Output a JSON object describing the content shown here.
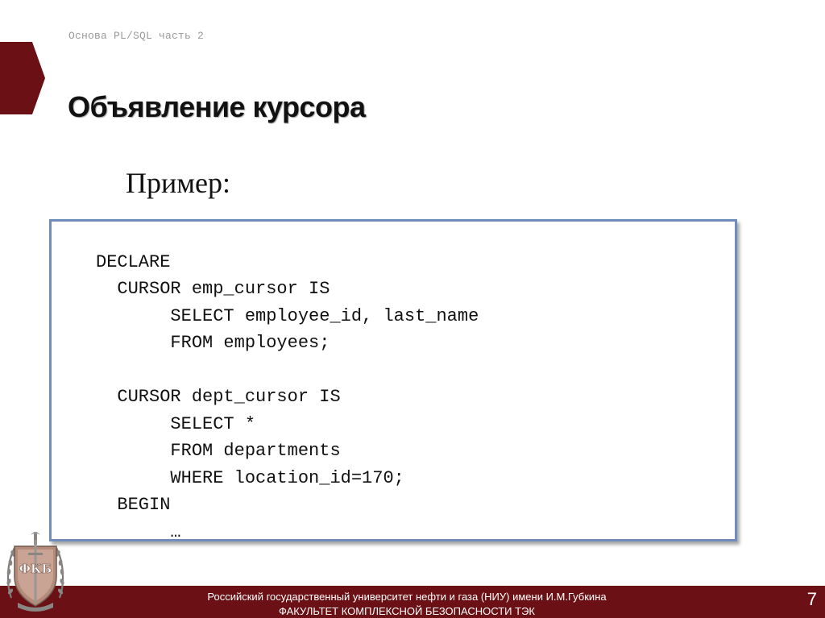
{
  "header": {
    "subtitle": "Основа PL/SQL часть 2"
  },
  "title": "Объявление курсора",
  "example_label": "Пример:",
  "code": {
    "lines": [
      "DECLARE",
      "  CURSOR emp_cursor IS",
      "       SELECT employee_id, last_name",
      "       FROM employees;",
      "",
      "  CURSOR dept_cursor IS",
      "       SELECT *",
      "       FROM departments",
      "       WHERE location_id=170;",
      "  BEGIN",
      "       …"
    ]
  },
  "footer": {
    "university": "Российский государственный университет нефти и газа (НИУ) имени И.М.Губкина",
    "faculty": "ФАКУЛЬТЕТ КОМПЛЕКСНОЙ БЕЗОПАСНОСТИ ТЭК",
    "page_number": "7"
  },
  "logo": {
    "icon": "faculty-emblem-icon",
    "text": "ФКБ"
  },
  "colors": {
    "accent": "#6b1115",
    "code_border": "#6f8cbd"
  }
}
